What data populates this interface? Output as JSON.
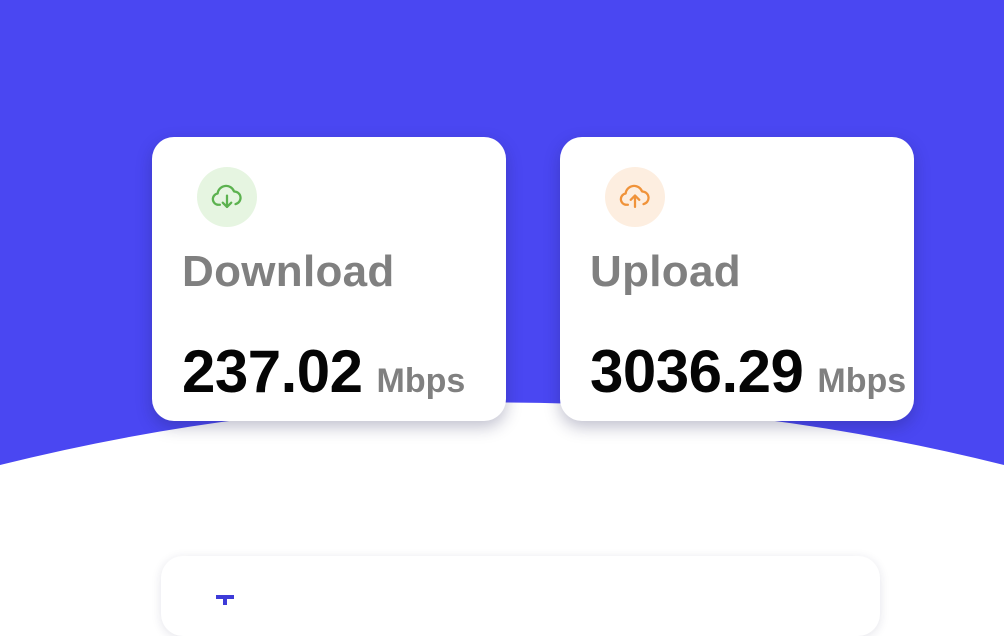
{
  "colors": {
    "hero_background": "#4a47f2",
    "download_accent": "#5cb24f",
    "download_icon_bg": "#e6f5e1",
    "upload_accent": "#f0933a",
    "upload_icon_bg": "#fdeee0"
  },
  "download": {
    "icon": "cloud-download-icon",
    "label": "Download",
    "value": "237.02",
    "unit": "Mbps"
  },
  "upload": {
    "icon": "cloud-upload-icon",
    "label": "Upload",
    "value": "3036.29",
    "unit": "Mbps"
  }
}
